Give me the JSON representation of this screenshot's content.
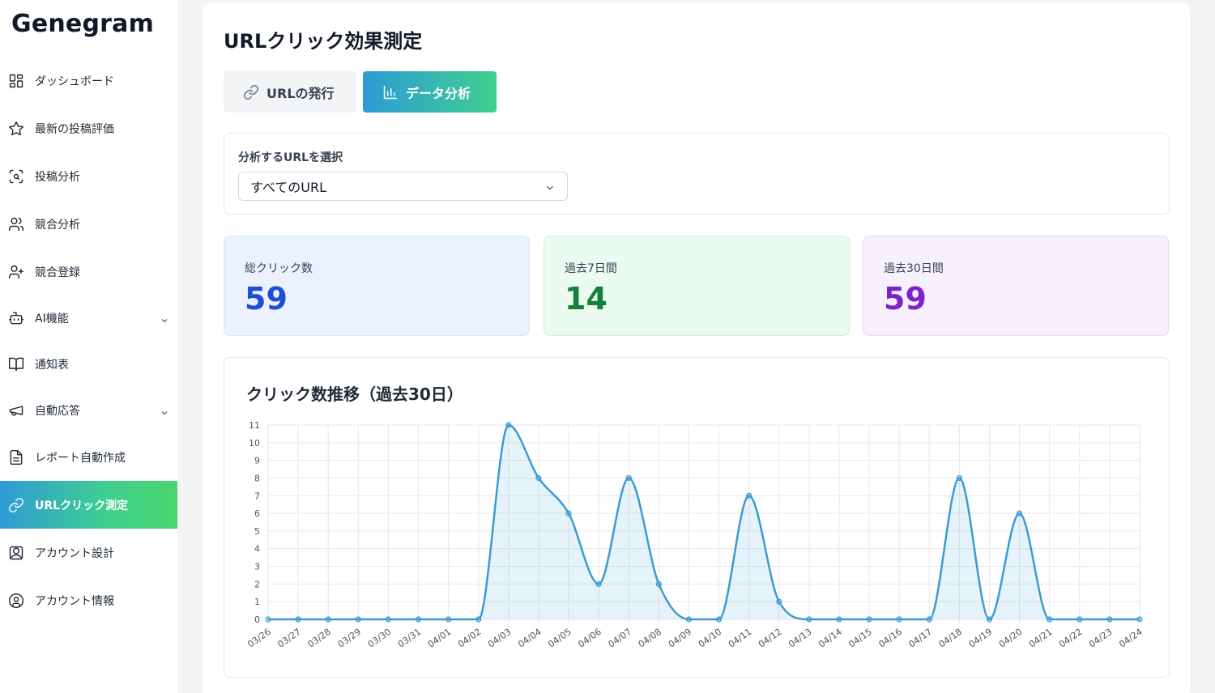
{
  "app": {
    "logo": "Genegram"
  },
  "sidebar": {
    "items": [
      {
        "label": "ダッシュボード",
        "icon": "dashboard-grid-icon"
      },
      {
        "label": "最新の投稿評価",
        "icon": "star-icon"
      },
      {
        "label": "投稿分析",
        "icon": "scan-search-icon"
      },
      {
        "label": "競合分析",
        "icon": "users-icon"
      },
      {
        "label": "競合登録",
        "icon": "user-plus-icon"
      },
      {
        "label": "AI機能",
        "icon": "robot-icon",
        "expandable": true
      },
      {
        "label": "通知表",
        "icon": "book-open-icon"
      },
      {
        "label": "自動応答",
        "icon": "megaphone-icon",
        "expandable": true
      },
      {
        "label": "レポート自動作成",
        "icon": "file-text-icon"
      },
      {
        "label": "URLクリック測定",
        "icon": "link-icon",
        "active": true
      },
      {
        "label": "アカウント設計",
        "icon": "user-pin-icon"
      },
      {
        "label": "アカウント情報",
        "icon": "user-circle-icon"
      }
    ]
  },
  "main": {
    "title": "URLクリック効果測定",
    "tabs": [
      {
        "label": "URLの発行",
        "icon": "link-icon"
      },
      {
        "label": "データ分析",
        "icon": "bar-chart-icon",
        "active": true
      }
    ],
    "url_select": {
      "label": "分析するURLを選択",
      "value": "すべてのURL"
    },
    "stats": [
      {
        "label": "総クリック数",
        "value": "59",
        "color": "#1d4ed8"
      },
      {
        "label": "過去7日間",
        "value": "14",
        "color": "#15803d"
      },
      {
        "label": "過去30日間",
        "value": "59",
        "color": "#7e22ce"
      }
    ],
    "chart_title": "クリック数推移（過去30日）"
  },
  "colors": {
    "accent_start": "#2e9bd6",
    "accent_end": "#4ad66d",
    "line": "#3b9bd4"
  },
  "chart_data": {
    "type": "line",
    "title": "クリック数推移（過去30日）",
    "categories": [
      "03/26",
      "03/27",
      "03/28",
      "03/29",
      "03/30",
      "03/31",
      "04/01",
      "04/02",
      "04/03",
      "04/04",
      "04/05",
      "04/06",
      "04/07",
      "04/08",
      "04/09",
      "04/10",
      "04/11",
      "04/12",
      "04/13",
      "04/14",
      "04/15",
      "04/16",
      "04/17",
      "04/18",
      "04/19",
      "04/20",
      "04/21",
      "04/22",
      "04/23",
      "04/24"
    ],
    "series": [
      {
        "values": [
          0,
          0,
          0,
          0,
          0,
          0,
          0,
          0,
          11,
          8,
          6,
          2,
          8,
          2,
          0,
          0,
          7,
          1,
          0,
          0,
          0,
          0,
          0,
          8,
          0,
          6,
          0,
          0,
          0,
          0
        ]
      }
    ],
    "ylim": [
      0,
      11
    ],
    "yticks": [
      0,
      1,
      2,
      3,
      4,
      5,
      6,
      7,
      8,
      9,
      10,
      11
    ],
    "grid": true,
    "fill": true
  }
}
